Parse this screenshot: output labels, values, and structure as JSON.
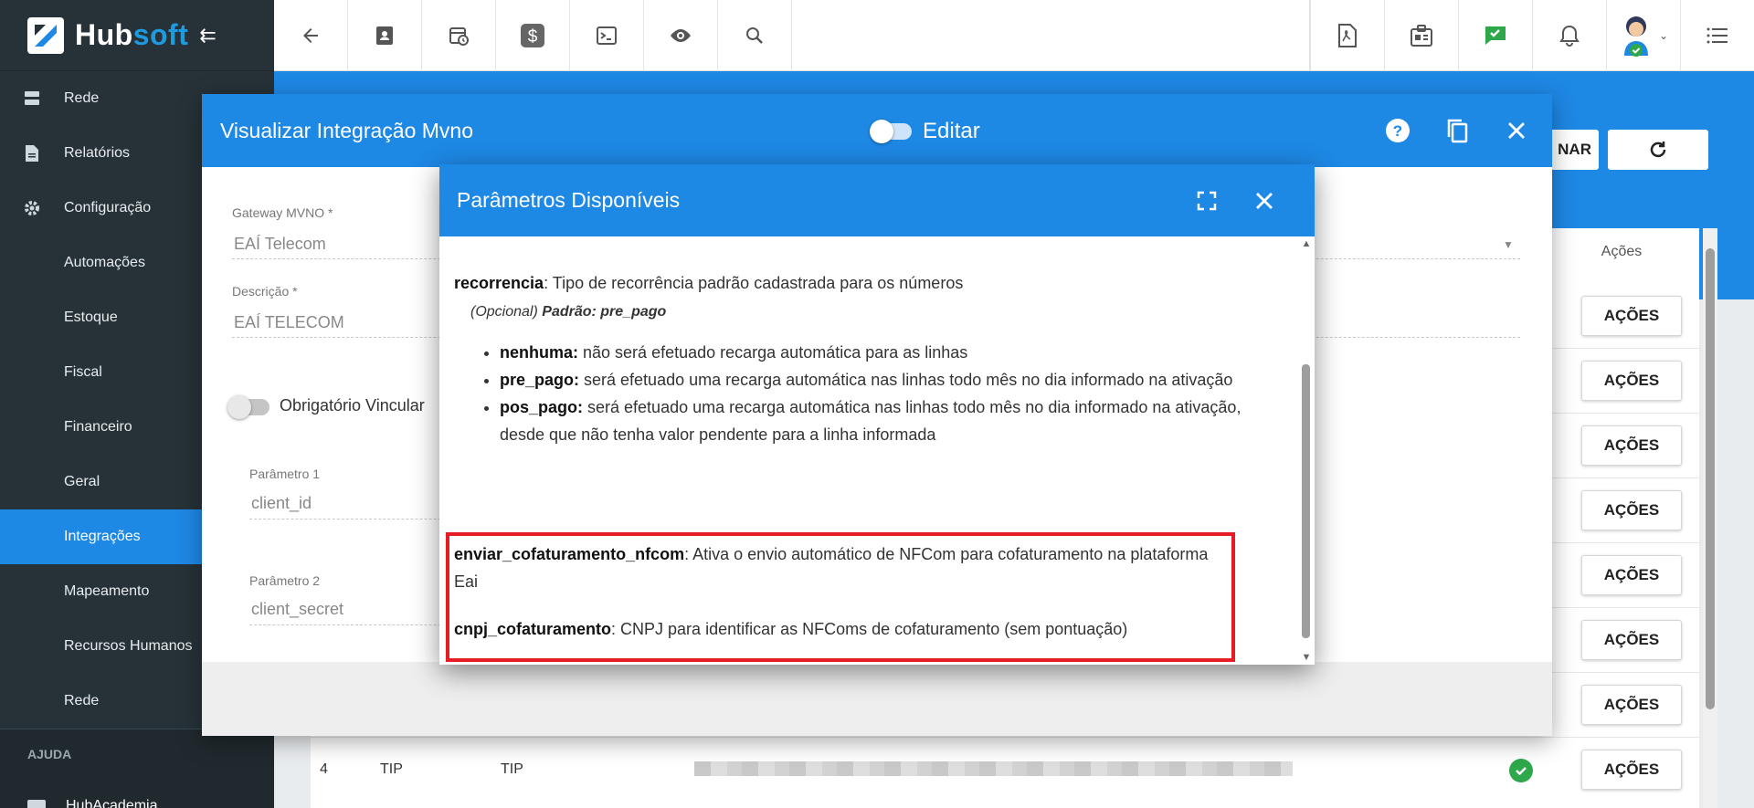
{
  "brand": {
    "part1": "Hub",
    "part2": "soft"
  },
  "sidebar": {
    "items": [
      {
        "label": "Rede",
        "icon": "server-icon",
        "sub": false
      },
      {
        "label": "Relatórios",
        "icon": "document-icon",
        "sub": false
      },
      {
        "label": "Configuração",
        "icon": "gear-icon",
        "sub": false
      },
      {
        "label": "Automações",
        "sub": true
      },
      {
        "label": "Estoque",
        "sub": true
      },
      {
        "label": "Fiscal",
        "sub": true
      },
      {
        "label": "Financeiro",
        "sub": true
      },
      {
        "label": "Geral",
        "sub": true
      },
      {
        "label": "Integrações",
        "sub": true,
        "active": true
      },
      {
        "label": "Mapeamento",
        "sub": true
      },
      {
        "label": "Recursos Humanos",
        "sub": true
      },
      {
        "label": "Rede",
        "sub": true
      }
    ],
    "section_label": "AJUDA",
    "last_item": "HubAcademia"
  },
  "background": {
    "btn_partial": "NAR",
    "acoes_header": "Ações",
    "acoes_label": "AÇÕES",
    "last_row": {
      "num": "4",
      "col1": "TIP",
      "col2": "TIP"
    }
  },
  "modal1": {
    "title": "Visualizar Integração Mvno",
    "toggle_label": "Editar",
    "gateway_label": "Gateway MVNO",
    "gateway_value": "EAÍ Telecom",
    "descricao_label": "Descrição",
    "descricao_value": "EAÍ TELECOM",
    "obrigatorio_label": "Obrigatório Vincular",
    "param1_label": "Parâmetro 1",
    "param1_value": "client_id",
    "param2_label": "Parâmetro 2",
    "param2_value": "client_secret"
  },
  "modal2": {
    "title": "Parâmetros Disponíveis",
    "recorrencia": {
      "name": "recorrencia",
      "desc": ": Tipo de recorrência padrão cadastrada para os números",
      "opt_prefix": "(Opcional)",
      "opt_default": "Padrão: pre_pago",
      "options": [
        {
          "name": "nenhuma:",
          "desc": " não será efetuado recarga automática para as linhas"
        },
        {
          "name": "pre_pago:",
          "desc": " será efetuado uma recarga automática nas linhas todo mês no dia informado na ativação"
        },
        {
          "name": "pos_pago:",
          "desc": " será efetuado uma recarga automática nas linhas todo mês no dia informado na ativação, desde que não tenha valor pendente para a linha informada"
        }
      ]
    },
    "enviar": {
      "name": "enviar_cofaturamento_nfcom",
      "desc": ": Ativa o envio automático de NFCom para cofaturamento na plataforma Eai"
    },
    "cnpj": {
      "name": "cnpj_cofaturamento",
      "desc": ": CNPJ para identificar as NFComs de cofaturamento (sem pontuação)"
    }
  }
}
